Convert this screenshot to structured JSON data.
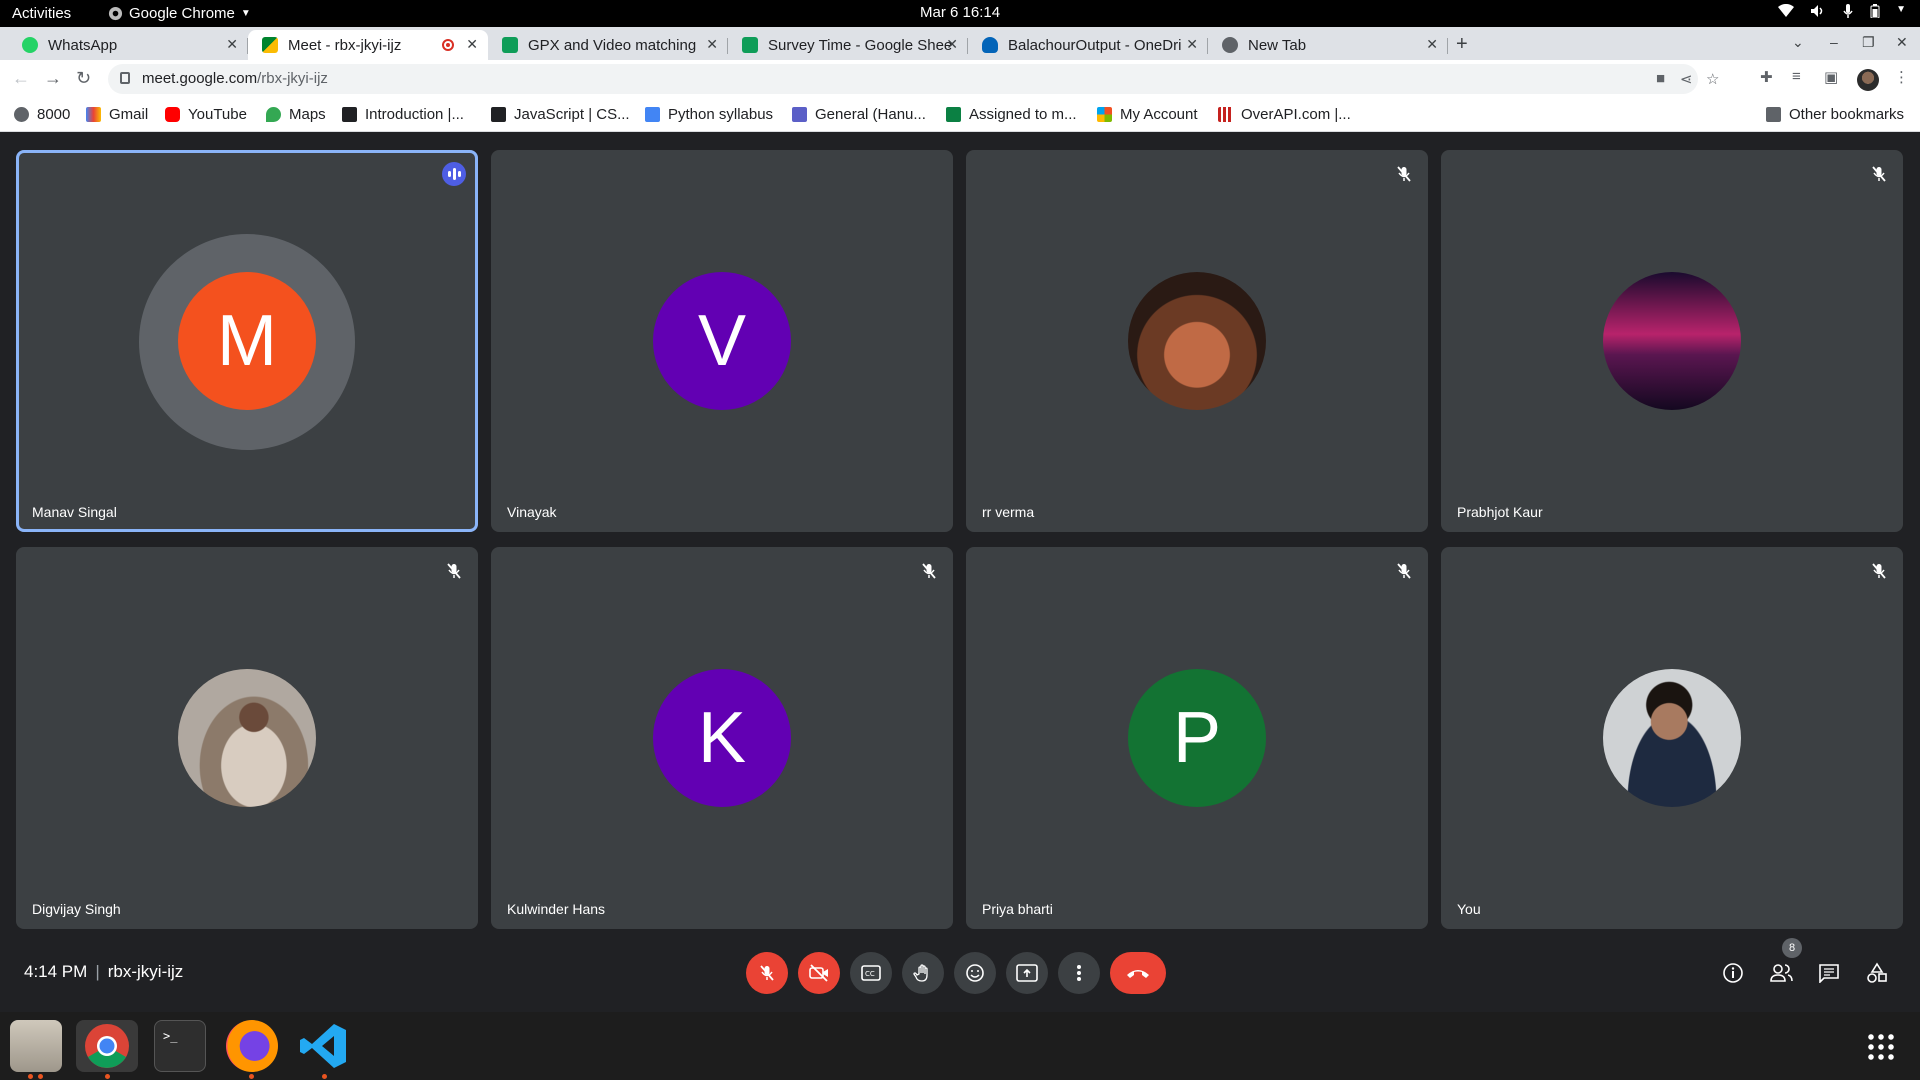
{
  "topbar": {
    "activities": "Activities",
    "app_name": "Google Chrome",
    "clock": "Mar 6  16:14"
  },
  "tabs": [
    {
      "label": "WhatsApp",
      "favicon_color": "#25d366"
    },
    {
      "label": "Meet - rbx-jkyi-ijz",
      "favicon_color": "#00832d"
    },
    {
      "label": "GPX and Video matching",
      "favicon_color": "#0f9d58"
    },
    {
      "label": "Survey Time - Google Shee",
      "favicon_color": "#0f9d58"
    },
    {
      "label": "BalachourOutput - OneDri",
      "favicon_color": "#0364b8"
    },
    {
      "label": "New Tab",
      "favicon_color": "#5f6368"
    }
  ],
  "address": {
    "host": "meet.google.com",
    "path": "/rbx-jkyi-ijz"
  },
  "bookmarks": [
    {
      "label": "8000",
      "icon": "globe-icon"
    },
    {
      "label": "Gmail",
      "icon": "gmail-icon"
    },
    {
      "label": "YouTube",
      "icon": "youtube-icon"
    },
    {
      "label": "Maps",
      "icon": "maps-icon"
    },
    {
      "label": "Introduction |...",
      "icon": "bookmark-x-icon"
    },
    {
      "label": "JavaScript | CS...",
      "icon": "bookmark-x-icon"
    },
    {
      "label": "Python syllabus",
      "icon": "docs-icon"
    },
    {
      "label": "General (Hanu...",
      "icon": "teams-icon"
    },
    {
      "label": "Assigned to m...",
      "icon": "flag-icon"
    },
    {
      "label": "My Account",
      "icon": "microsoft-icon"
    },
    {
      "label": "OverAPI.com |...",
      "icon": "overapi-icon"
    }
  ],
  "other_bookmarks": "Other bookmarks",
  "participants": [
    {
      "name": "Manav Singal",
      "initial": "M",
      "avatar_color": "#f4511e",
      "state": "speaking"
    },
    {
      "name": "Vinayak",
      "initial": "V",
      "avatar_color": "#6200b3",
      "state": "none"
    },
    {
      "name": "rr verma",
      "initial": "",
      "avatar_color": "#6b3a24",
      "state": "muted"
    },
    {
      "name": "Prabhjot Kaur",
      "initial": "",
      "avatar_color": "#7a1f5c",
      "state": "muted"
    },
    {
      "name": "Digvijay Singh",
      "initial": "",
      "avatar_color": "#9c8a7a",
      "state": "muted"
    },
    {
      "name": "Kulwinder Hans",
      "initial": "K",
      "avatar_color": "#6200b3",
      "state": "muted"
    },
    {
      "name": "Priya bharti",
      "initial": "P",
      "avatar_color": "#137333",
      "state": "muted"
    },
    {
      "name": "You",
      "initial": "",
      "avatar_color": "#3a3a3a",
      "state": "muted"
    }
  ],
  "meeting": {
    "time": "4:14 PM",
    "code": "rbx-jkyi-ijz",
    "participant_count": "8"
  },
  "colors": {
    "speaking_outline": "#8ab4f8",
    "danger_button": "#ea4335"
  }
}
